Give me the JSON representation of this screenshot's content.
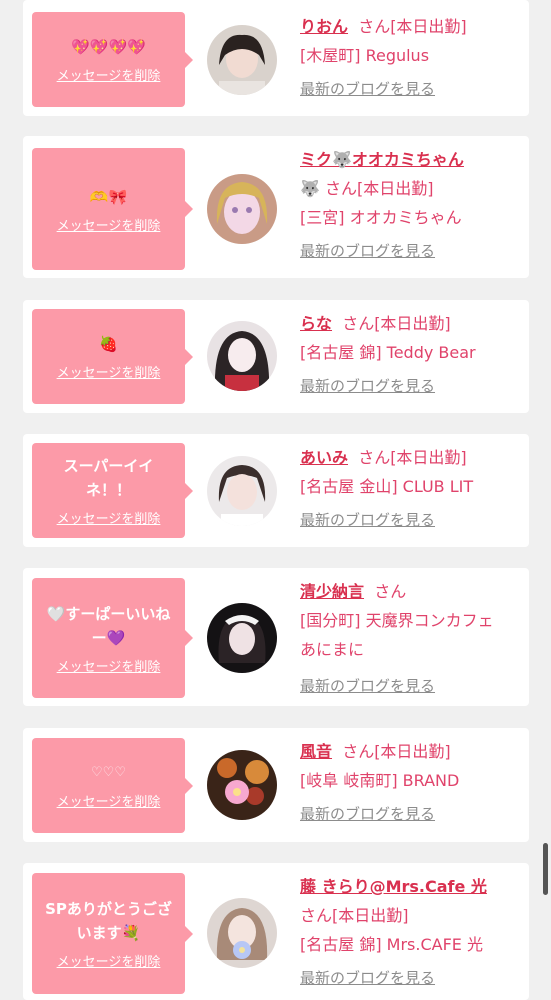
{
  "accent_colors": {
    "bubble": "#fc9aa8",
    "name": "#d9304f",
    "text": "#e0436b",
    "link": "#8c8c8c",
    "background": "#f0f0f0"
  },
  "messages": [
    {
      "message": "💖💖💖💖",
      "delete_label": "メッセージを削除",
      "name": "りおん",
      "line1_suffix": "さん[本日出勤]",
      "line2": "[木屋町] Regulus",
      "line3": "",
      "blog_label": "最新のブログを見る",
      "avatar_icon": "avatar-photo-icon"
    },
    {
      "message": "🫶🎀",
      "delete_label": "メッセージを削除",
      "name": "ミク🐺オオカミちゃん",
      "line1_suffix": "🐺 さん[本日出勤]",
      "line2": "[三宮] オオカミちゃん",
      "line3": "",
      "blog_label": "最新のブログを見る",
      "avatar_icon": "avatar-photo-icon"
    },
    {
      "message": "🍓",
      "delete_label": "メッセージを削除",
      "name": "らな",
      "line1_suffix": "さん[本日出勤]",
      "line2": "[名古屋 錦] Teddy Bear",
      "line3": "",
      "blog_label": "最新のブログを見る",
      "avatar_icon": "avatar-photo-icon"
    },
    {
      "message": "スーパーイイ\nネ！！",
      "delete_label": "メッセージを削除",
      "name": "あいみ",
      "line1_suffix": "さん[本日出勤]",
      "line2": "[名古屋 金山] CLUB LIT",
      "line3": "",
      "blog_label": "最新のブログを見る",
      "avatar_icon": "avatar-photo-icon"
    },
    {
      "message": "🤍すーぱーいいね\nー💜",
      "delete_label": "メッセージを削除",
      "name": "清少納言",
      "line1_suffix": "さん",
      "line2": "[国分町] 天魔界コンカフェ",
      "line3": "あにまに",
      "blog_label": "最新のブログを見る",
      "avatar_icon": "avatar-photo-icon"
    },
    {
      "message": "♡♡♡",
      "delete_label": "メッセージを削除",
      "name": "風音",
      "line1_suffix": "さん[本日出勤]",
      "line2": "[岐阜 岐南町] BRAND",
      "line3": "",
      "blog_label": "最新のブログを見る",
      "avatar_icon": "avatar-photo-icon"
    },
    {
      "message": "SPありがとうござ\nいます💐",
      "delete_label": "メッセージを削除",
      "name": "藤 きらり@Mrs.Cafe 光",
      "line1_suffix": "さん[本日出勤]",
      "line2": "[名古屋 錦] Mrs.CAFE 光",
      "line3": "",
      "blog_label": "最新のブログを見る",
      "avatar_icon": "avatar-photo-icon"
    }
  ]
}
